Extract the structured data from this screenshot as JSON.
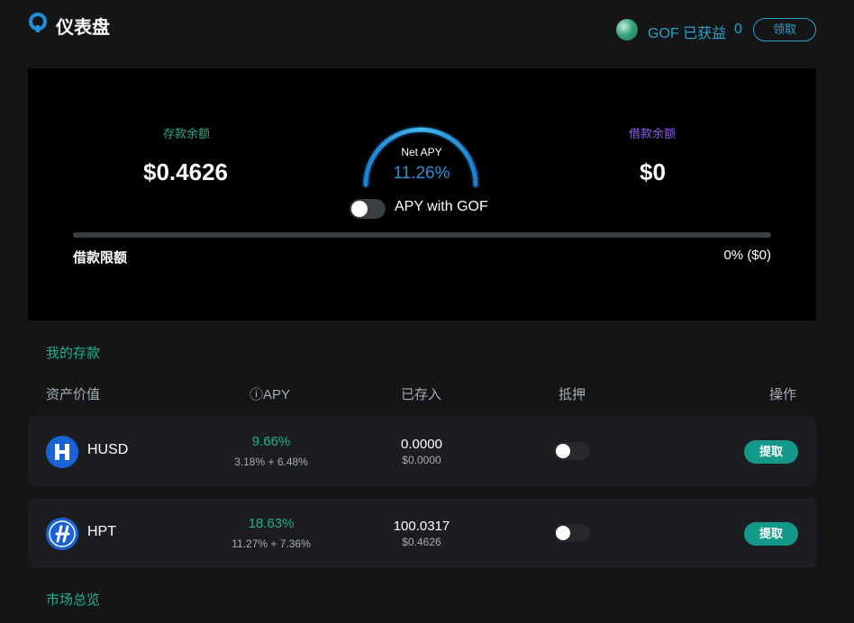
{
  "header": {
    "title": "仪表盘",
    "gof_label": "GOF 已获益",
    "gof_value": "0",
    "claim_label": "领取"
  },
  "summary": {
    "deposit_label": "存款余额",
    "deposit_value": "$0.4626",
    "net_apy_label": "Net APY",
    "net_apy_value": "11.26%",
    "apy_with_gof_label": "APY with GOF",
    "apy_with_gof_on": false,
    "borrow_label": "借款余额",
    "borrow_value": "$0",
    "borrow_limit_label": "借款限额",
    "borrow_limit_value": "0% ($0)",
    "borrow_limit_fraction": 0
  },
  "deposits": {
    "title": "我的存款",
    "columns": [
      "资产价值",
      "ⓘAPY",
      "已存入",
      "抵押",
      "操作"
    ],
    "rows": [
      {
        "asset": "HUSD",
        "apy": "9.66%",
        "apy_breakdown": "3.18% + 6.48%",
        "deposited": "0.0000",
        "deposited_usd": "$0.0000",
        "collateral_on": false,
        "action": "提取"
      },
      {
        "asset": "HPT",
        "apy": "18.63%",
        "apy_breakdown": "11.27% + 7.36%",
        "deposited": "100.0317",
        "deposited_usd": "$0.4626",
        "collateral_on": false,
        "action": "提取"
      }
    ]
  },
  "market": {
    "title": "市场总览"
  },
  "colors": {
    "accent_green": "#1fb08f",
    "accent_blue": "#2aa0c8",
    "accent_purple": "#8a5fe0",
    "button_teal": "#14988a"
  }
}
